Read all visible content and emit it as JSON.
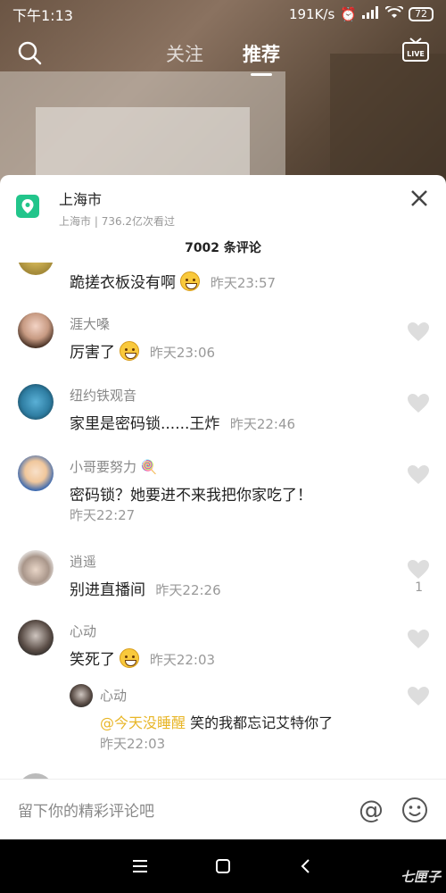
{
  "status_bar": {
    "time": "下午1:13",
    "speed": "191K/s",
    "network": "4G",
    "battery": "72"
  },
  "top_nav": {
    "tabs": [
      {
        "label": "关注",
        "active": false
      },
      {
        "label": "推荐",
        "active": true
      }
    ],
    "live_label": "LIVE"
  },
  "location": {
    "city": "上海市",
    "sub_city": "上海市",
    "views": "736.2亿次看过"
  },
  "comment_count": "7002 条评论",
  "comments": [
    {
      "name": "",
      "text": "跪搓衣板没有啊",
      "emoji": true,
      "time": "昨天23:57",
      "likes": ""
    },
    {
      "name": "涯大嗓",
      "text": "厉害了",
      "emoji": true,
      "time": "昨天23:06",
      "likes": ""
    },
    {
      "name": "纽约铁观音",
      "text": "家里是密码锁......王炸",
      "emoji": false,
      "time": "昨天22:46",
      "likes": ""
    },
    {
      "name": "小哥要努力",
      "text": "密码锁？她要进不来我把你家吃了！",
      "emoji": false,
      "time": "昨天22:27",
      "likes": ""
    },
    {
      "name": "逍遥",
      "text": "别进直播间",
      "emoji": false,
      "time": "昨天22:26",
      "likes": "1"
    },
    {
      "name": "心动",
      "text": "笑死了",
      "emoji": true,
      "time": "昨天22:03",
      "likes": ""
    }
  ],
  "reply": {
    "name": "心动",
    "mention": "@今天没睡醒",
    "text": "笑的我都忘记艾特你了",
    "time": "昨天22:03"
  },
  "input": {
    "placeholder": "留下你的精彩评论吧",
    "at_symbol": "@"
  },
  "watermark": "七匣子",
  "colors": {
    "location_icon": "#22c58b",
    "mention": "#e8b628"
  }
}
